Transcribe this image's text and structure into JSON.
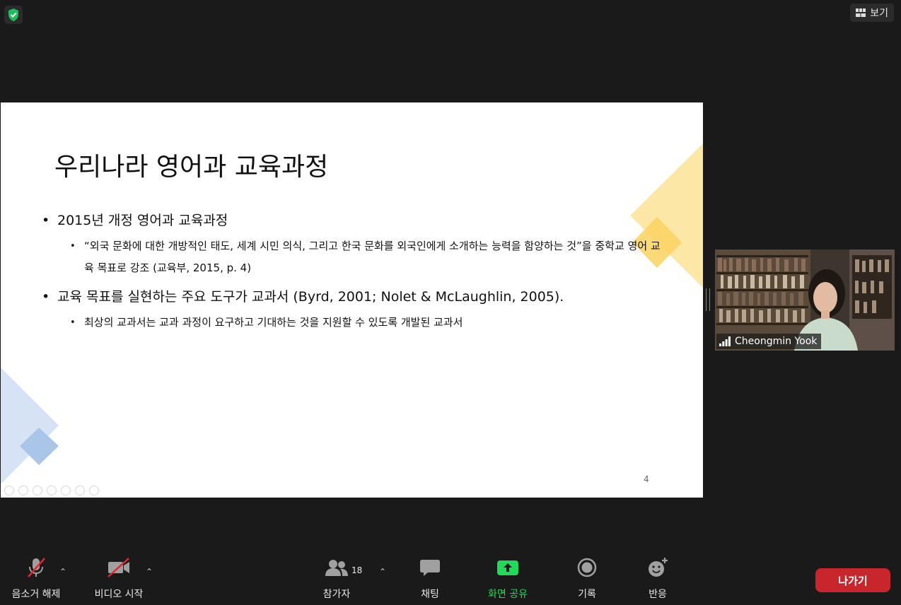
{
  "header": {
    "view_label": "보기"
  },
  "slide": {
    "title": "우리나라 영어과 교육과정",
    "bullets": [
      {
        "text": "2015년 개정 영어과 교육과정",
        "sub": [
          "“외국 문화에 대한 개방적인 태도, 세계 시민 의식, 그리고 한국 문화를 외국인에게 소개하는 능력을 함양하는 것”을 중학교 영어 교육 목표로 강조 (교육부, 2015, p. 4)"
        ]
      },
      {
        "text": "교육 목표를 실현하는 주요 도구가 교과서 (Byrd, 2001; Nolet & McLaughlin, 2005).",
        "sub": [
          "최상의 교과서는 교과 과정이 요구하고 기대하는 것을 지원할 수 있도록 개발된 교과서"
        ]
      }
    ],
    "page_number": "4"
  },
  "participant": {
    "name": "Cheongmin Yook"
  },
  "toolbar": {
    "mute_label": "음소거 해제",
    "video_label": "비디오 시작",
    "participants_label": "참가자",
    "participants_count": "18",
    "chat_label": "채팅",
    "share_label": "화면 공유",
    "record_label": "기록",
    "reactions_label": "반응",
    "leave_label": "나가기"
  },
  "colors": {
    "share_green": "#23d959",
    "leave_red": "#c8252c",
    "mute_red": "#e0262e",
    "shield_green": "#1ebe5d"
  }
}
